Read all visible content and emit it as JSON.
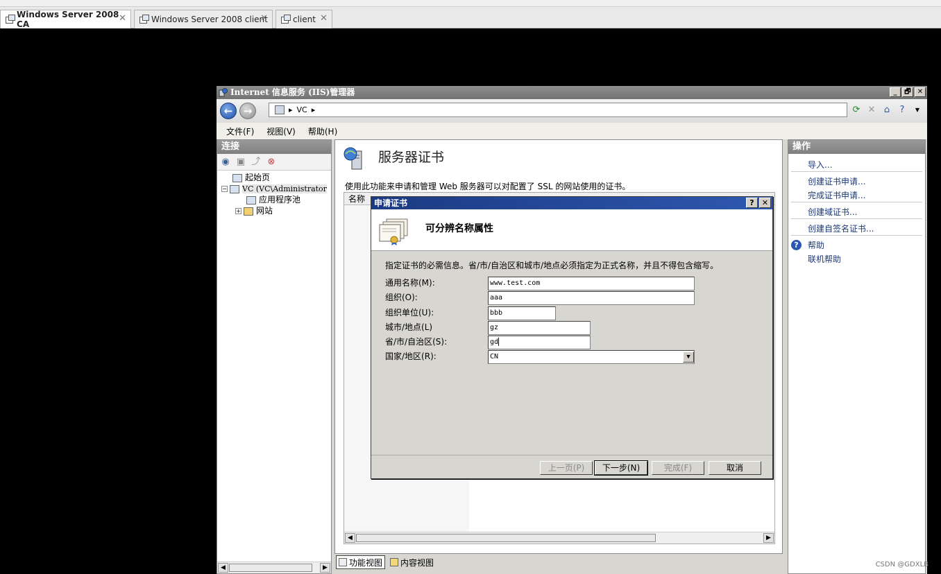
{
  "browser": {
    "tabs": [
      {
        "label": "Windows Server 2008 CA",
        "active": true
      },
      {
        "label": "Windows Server 2008 client",
        "active": false
      },
      {
        "label": "client",
        "active": false
      }
    ],
    "close_glyph": "✕"
  },
  "iis": {
    "title": "Internet 信息服务 (IIS)管理器",
    "window_buttons": [
      "_",
      "🗗",
      "✕"
    ],
    "address": {
      "segments": [
        "VC"
      ]
    },
    "menu": [
      "文件(F)",
      "视图(V)",
      "帮助(H)"
    ],
    "connections": {
      "title": "连接",
      "tree": [
        {
          "label": "起始页"
        },
        {
          "label": "VC (VC\\Administrator",
          "expander": "−"
        },
        {
          "label": "应用程序池"
        },
        {
          "label": "网站",
          "expander": "+"
        }
      ]
    },
    "center": {
      "title": "服务器证书",
      "description": "使用此功能来申请和管理 Web 服务器可以对配置了 SSL 的网站使用的证书。",
      "column_header": "名称"
    },
    "bottom_tabs": [
      "功能视图",
      "内容视图"
    ],
    "actions": {
      "title": "操作",
      "items": [
        "导入...",
        "创建证书申请...",
        "完成证书申请...",
        "创建域证书...",
        "创建自签名证书..."
      ],
      "help": "帮助",
      "online_help": "联机帮助"
    }
  },
  "dialog": {
    "title": "申请证书",
    "title_buttons": [
      "?",
      "✕"
    ],
    "header": "可分辨名称属性",
    "instruction": "指定证书的必需信息。省/市/自治区和城市/地点必须指定为正式名称，并且不得包含缩写。",
    "fields": [
      {
        "label": "通用名称(M):",
        "value": "www.test.com"
      },
      {
        "label": "组织(O):",
        "value": "aaa"
      },
      {
        "label": "组织单位(U):",
        "value": "bbb"
      },
      {
        "label": "城市/地点(L)",
        "value": "gz"
      },
      {
        "label": "省/市/自治区(S):",
        "value": "gd"
      },
      {
        "label": "国家/地区(R):",
        "value": "CN"
      }
    ],
    "buttons": {
      "prev": "上一页(P)",
      "next": "下一步(N)",
      "finish": "完成(F)",
      "cancel": "取消"
    }
  },
  "watermark": "CSDN @GDXLB"
}
